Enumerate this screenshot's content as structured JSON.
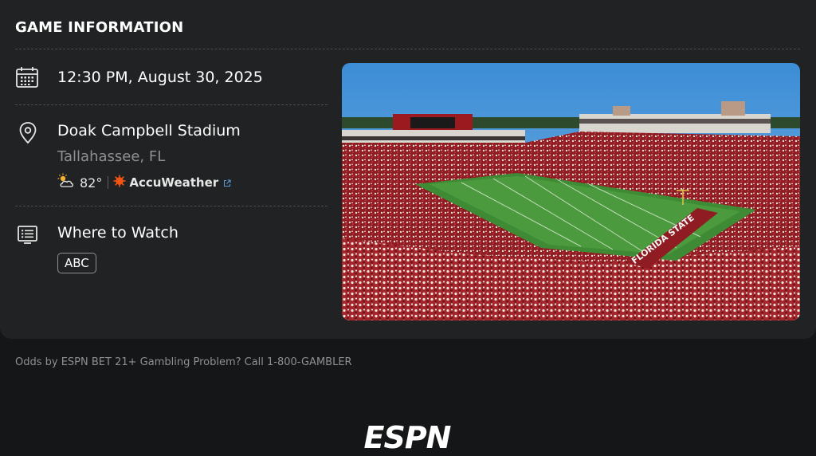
{
  "game_info": {
    "title": "GAME INFORMATION",
    "datetime": "12:30 PM, August 30, 2025",
    "venue_name": "Doak Campbell Stadium",
    "venue_location": "Tallahassee, FL",
    "weather": {
      "icon": "partly-cloudy-icon",
      "temperature": "82°",
      "provider": "AccuWeather"
    },
    "where_to_watch": {
      "label": "Where to Watch",
      "network": "ABC"
    },
    "photo": {
      "field_text": "FLORIDA STATE"
    }
  },
  "footer": {
    "odds_note": "Odds by ESPN BET 21+ Gambling Problem? Call 1-800-GAMBLER",
    "logo_text": "ESPN"
  },
  "colors": {
    "background": "#151617",
    "card": "#202223",
    "secondary_text": "#8d9093",
    "accuweather_orange": "#f05514",
    "link_blue": "#5b9bd5"
  }
}
